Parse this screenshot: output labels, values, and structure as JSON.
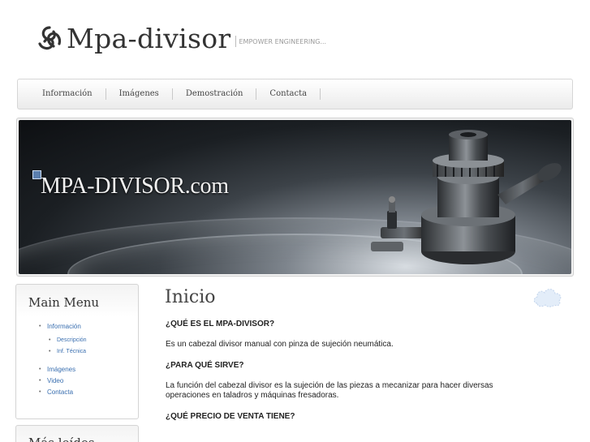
{
  "header": {
    "logo_text": "Mpa-divisor",
    "tagline": "EMPOWER ENGINEERING..."
  },
  "nav": {
    "items": [
      {
        "label": "Información"
      },
      {
        "label": "Imágenes"
      },
      {
        "label": "Demostración"
      },
      {
        "label": "Contacta"
      }
    ]
  },
  "banner": {
    "title": "MPA-DIVISOR.com"
  },
  "sidebar": {
    "main_menu_title": "Main Menu",
    "items": [
      {
        "label": "Información"
      },
      {
        "label": "Imágenes"
      },
      {
        "label": "Video"
      },
      {
        "label": "Contacta"
      }
    ],
    "sub_items": [
      {
        "label": "Descripción"
      },
      {
        "label": "Inf. Técnica"
      }
    ],
    "mas_leidos_title": "Más leídos"
  },
  "content": {
    "title": "Inicio",
    "q1": "¿QUÉ ES EL MPA-DIVISOR?",
    "a1": "Es un cabezal divisor manual con pinza de sujeción neumática.",
    "q2": "¿PARA QUÉ SIRVE?",
    "a2": "La función del cabezal divisor es la sujeción de las piezas a mecanizar para hacer diversas operaciones en taladros y máquinas fresadoras.",
    "q3": "¿QUÉ PRECIO DE VENTA TIENE?"
  },
  "colors": {
    "link": "#3a6fb0",
    "banner_bg": "#1b1f23"
  },
  "icons": [
    "logo-knot-icon",
    "broken-image-icon",
    "cloud-icon"
  ]
}
